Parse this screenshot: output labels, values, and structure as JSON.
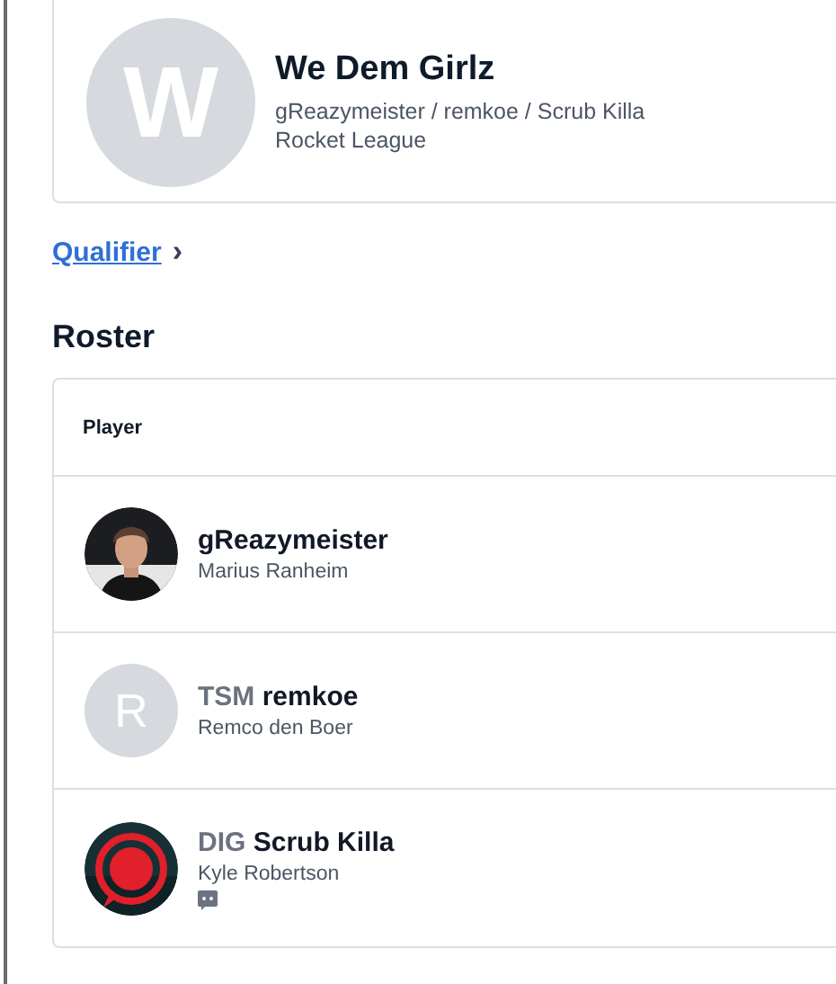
{
  "team": {
    "avatar_letter": "W",
    "name": "We Dem Girlz",
    "members": "gReazymeister / remkoe / Scrub Killa",
    "game": "Rocket League"
  },
  "link": {
    "label": "Qualifier",
    "chevron": "›"
  },
  "roster": {
    "title": "Roster",
    "columns": [
      "Player"
    ],
    "rows": [
      {
        "nickname": "gReazymeister",
        "real_name": "Marius Ranheim",
        "chat_icon": false
      },
      {
        "kind": "letter",
        "avatar_letter": "R",
        "team_tag": "TSM",
        "nickname": "remkoe",
        "real_name": "Remco den Boer",
        "chat_icon": false
      },
      {
        "kind": "logo",
        "team_tag": "DIG",
        "nickname": "Scrub Killa",
        "real_name": "Kyle Robertson",
        "chat_icon": true
      }
    ]
  }
}
